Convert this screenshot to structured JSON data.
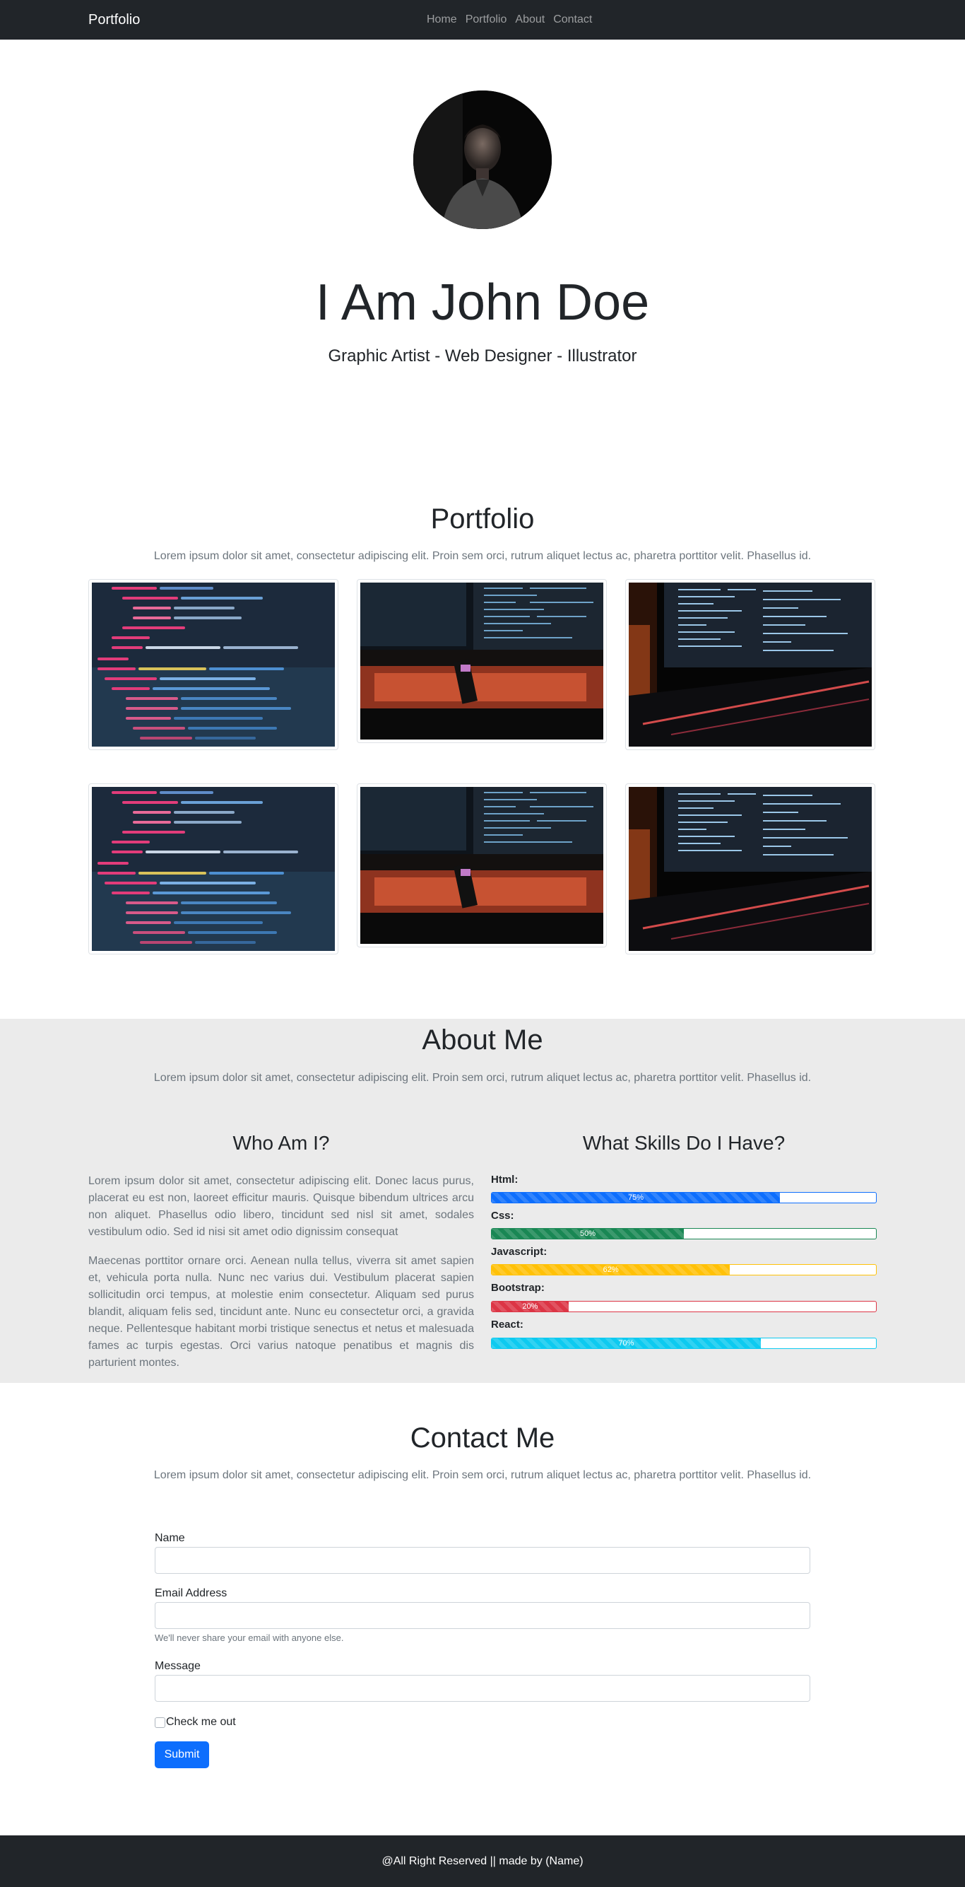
{
  "navbar": {
    "brand": "Portfolio",
    "links": [
      "Home",
      "Portfolio",
      "About",
      "Contact"
    ]
  },
  "hero": {
    "title": "I Am John Doe",
    "subtitle": "Graphic Artist - Web Designer - Illustrator"
  },
  "portfolio": {
    "title": "Portfolio",
    "lead": "Lorem ipsum dolor sit amet, consectetur adipiscing elit. Proin sem orci, rutrum aliquet lectus ac, pharetra porttitor velit. Phasellus id."
  },
  "about": {
    "title": "About Me",
    "lead": "Lorem ipsum dolor sit amet, consectetur adipiscing elit. Proin sem orci, rutrum aliquet lectus ac, pharetra porttitor velit. Phasellus id.",
    "who_title": "Who Am I?",
    "paragraph1": "Lorem ipsum dolor sit amet, consectetur adipiscing elit. Donec lacus purus, placerat eu est non, laoreet efficitur mauris. Quisque bibendum ultrices arcu non aliquet. Phasellus odio libero, tincidunt sed nisl sit amet, sodales vestibulum odio. Sed id nisi sit amet odio dignissim consequat",
    "paragraph2": "Maecenas porttitor ornare orci. Aenean nulla tellus, viverra sit amet sapien et, vehicula porta nulla. Nunc nec varius dui. Vestibulum placerat sapien sollicitudin orci tempus, at molestie enim consectetur. Aliquam sed purus blandit, aliquam felis sed, tincidunt ante. Nunc eu consectetur orci, a gravida neque. Pellentesque habitant morbi tristique senectus et netus et malesuada fames ac turpis egestas. Orci varius natoque penatibus et magnis dis parturient montes.",
    "skills_title": "What Skills Do I Have?",
    "skills": [
      {
        "label": "Html:",
        "value": "75%",
        "color": "#0d6efd"
      },
      {
        "label": "Css:",
        "value": "50%",
        "color": "#198754"
      },
      {
        "label": "Javascript:",
        "value": "62%",
        "color": "#ffc107"
      },
      {
        "label": "Bootstrap:",
        "value": "20%",
        "color": "#dc3545"
      },
      {
        "label": "React:",
        "value": "70%",
        "color": "#0dcaf0"
      }
    ]
  },
  "contact": {
    "title": "Contact Me",
    "lead": "Lorem ipsum dolor sit amet, consectetur adipiscing elit. Proin sem orci, rutrum aliquet lectus ac, pharetra porttitor velit. Phasellus id.",
    "name_label": "Name",
    "name_value": "",
    "email_label": "Email Address",
    "email_value": "",
    "email_help": "We'll never share your email with anyone else.",
    "message_label": "Message",
    "message_value": "",
    "check_label": "Check me out",
    "submit_label": "Submit"
  },
  "footer": {
    "text": "@All Right Reserved || made by (Name)"
  }
}
